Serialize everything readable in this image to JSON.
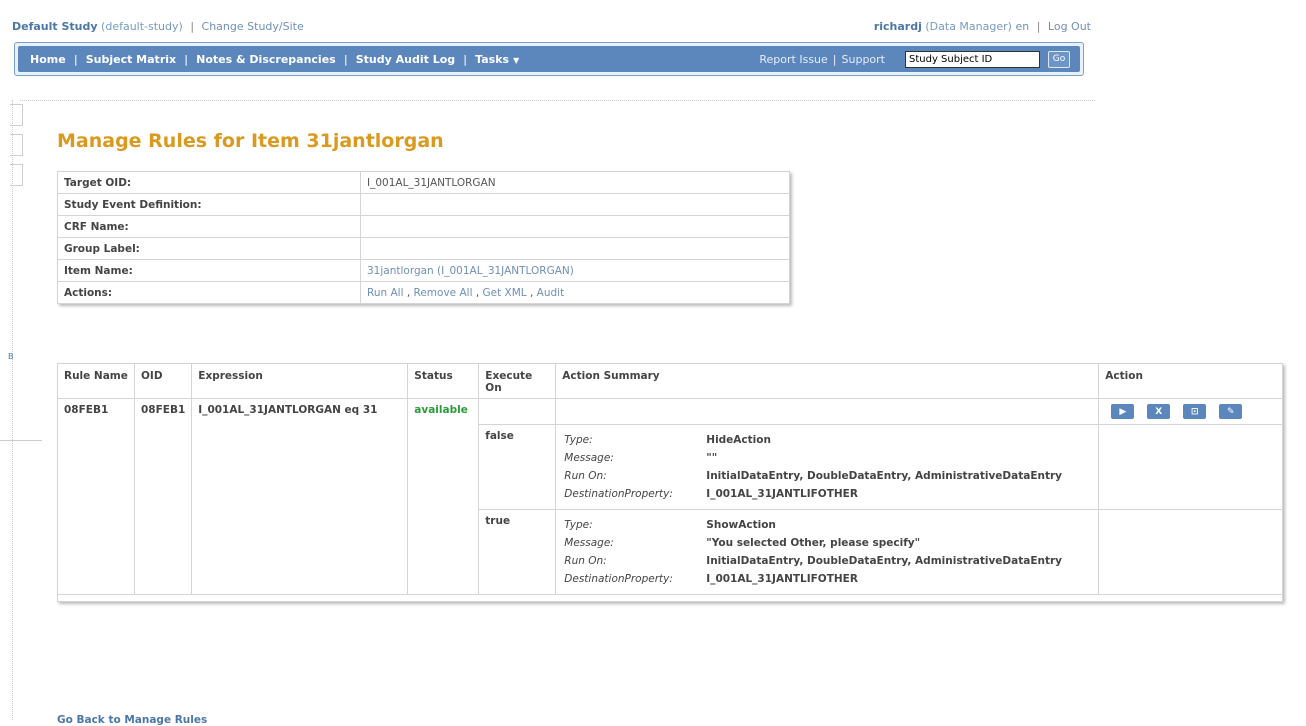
{
  "topbar": {
    "study_name": "Default Study",
    "study_id": "(default-study)",
    "separator": "|",
    "change_link": "Change Study/Site",
    "user": "richardj",
    "role": "(Data Manager)",
    "lang": "en",
    "logout": "Log Out"
  },
  "nav": {
    "items": [
      "Home",
      "Subject Matrix",
      "Notes & Discrepancies",
      "Study Audit Log",
      "Tasks"
    ],
    "separator": "|",
    "tasks_arrow": "▼",
    "report_issue": "Report Issue",
    "support": "Support",
    "search_value": "Study Subject ID",
    "go": "Go"
  },
  "title": "Manage Rules for Item 31jantlorgan",
  "info": {
    "target_oid_label": "Target OID:",
    "target_oid_value": "I_001AL_31JANTLORGAN",
    "sed_label": "Study Event Definition:",
    "sed_value": "",
    "crf_label": "CRF Name:",
    "crf_value": "",
    "group_label": "Group Label:",
    "group_value": "",
    "item_label": "Item Name:",
    "item_value": "31jantlorgan (I_001AL_31JANTLORGAN)",
    "actions_label": "Actions:",
    "actions": [
      "Run All",
      "Remove All",
      "Get XML",
      "Audit"
    ]
  },
  "rules": {
    "headers": {
      "rule_name": "Rule Name",
      "oid": "OID",
      "expression": "Expression",
      "status": "Status",
      "execute_on": "Execute On",
      "action_summary": "Action Summary",
      "action": "Action"
    },
    "row": {
      "rule_name": "08FEB1",
      "oid": "08FEB1",
      "expression": "I_001AL_31JANTLORGAN eq 31",
      "status": "available",
      "action_buttons": [
        "▶",
        "X",
        "⊡",
        "✎"
      ]
    },
    "labels": {
      "type": "Type:",
      "message": "Message:",
      "run_on": "Run On:",
      "destination": "DestinationProperty:"
    },
    "actions": [
      {
        "execute_on": "false",
        "type": "HideAction",
        "message": "\"\"",
        "run_on": "InitialDataEntry, DoubleDataEntry, AdministrativeDataEntry",
        "destination": "I_001AL_31JANTLIFOTHER"
      },
      {
        "execute_on": "true",
        "type": "ShowAction",
        "message": "\"You selected Other, please specify\"",
        "run_on": "InitialDataEntry, DoubleDataEntry, AdministrativeDataEntry",
        "destination": "I_001AL_31JANTLIFOTHER"
      }
    ]
  },
  "footer_link": "Go Back to Manage Rules",
  "colors": {
    "accent_title": "#d99a1f",
    "nav_bg": "#5b87bd",
    "status_available": "#2b9b3a",
    "link": "#6f8fb6"
  }
}
